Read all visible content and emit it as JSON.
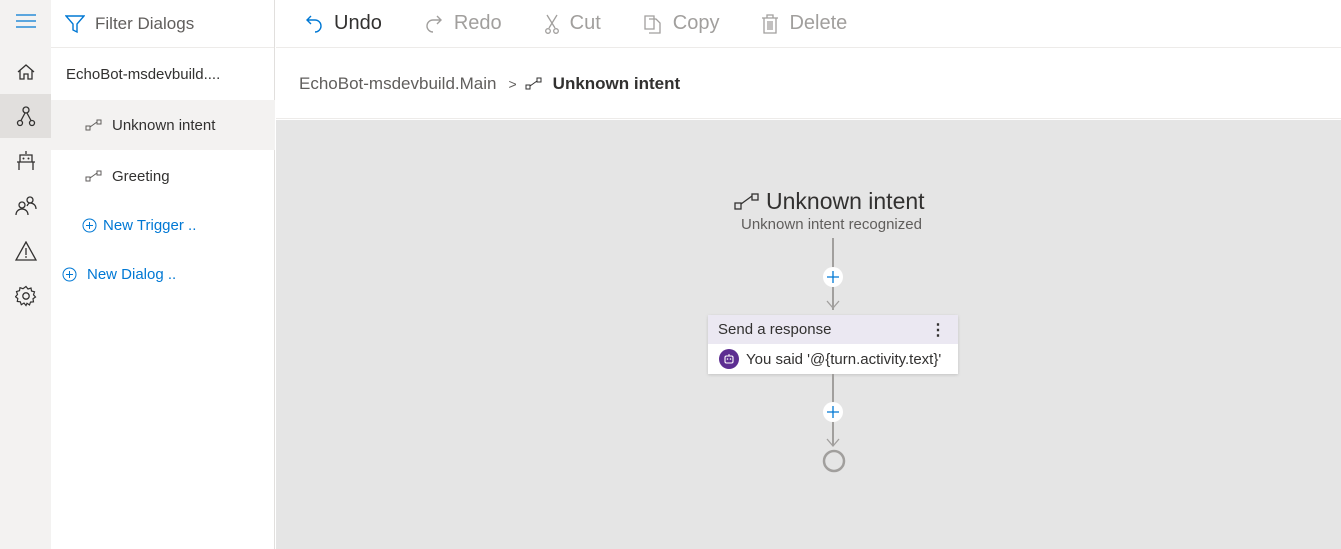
{
  "rail": {
    "items": [
      {
        "icon": "hamburger-menu-icon"
      },
      {
        "icon": "home-icon"
      },
      {
        "icon": "dialogs-icon",
        "selected": true
      },
      {
        "icon": "bot-responses-icon"
      },
      {
        "icon": "users-icon"
      },
      {
        "icon": "warning-icon"
      },
      {
        "icon": "settings-icon"
      }
    ]
  },
  "sidebar": {
    "filter_label": "Filter Dialogs",
    "dialog_name": "EchoBot-msdevbuild....",
    "triggers": [
      {
        "label": "Unknown intent",
        "selected": true
      },
      {
        "label": "Greeting",
        "selected": false
      }
    ],
    "new_trigger": "New Trigger ..",
    "new_dialog": "New Dialog .."
  },
  "toolbar": {
    "undo": "Undo",
    "redo": "Redo",
    "cut": "Cut",
    "copy": "Copy",
    "delete": "Delete"
  },
  "breadcrumb": {
    "parent": "EchoBot-msdevbuild.Main",
    "separator": ">",
    "current": "Unknown intent"
  },
  "canvas": {
    "trigger_title": "Unknown intent",
    "trigger_subtitle": "Unknown intent recognized",
    "action_card": {
      "title": "Send a response",
      "body": "You said '@{turn.activity.text}'"
    },
    "colors": {
      "accent": "#0078d4",
      "bot": "#5c2d91",
      "card_header": "#ebe8f2"
    }
  }
}
